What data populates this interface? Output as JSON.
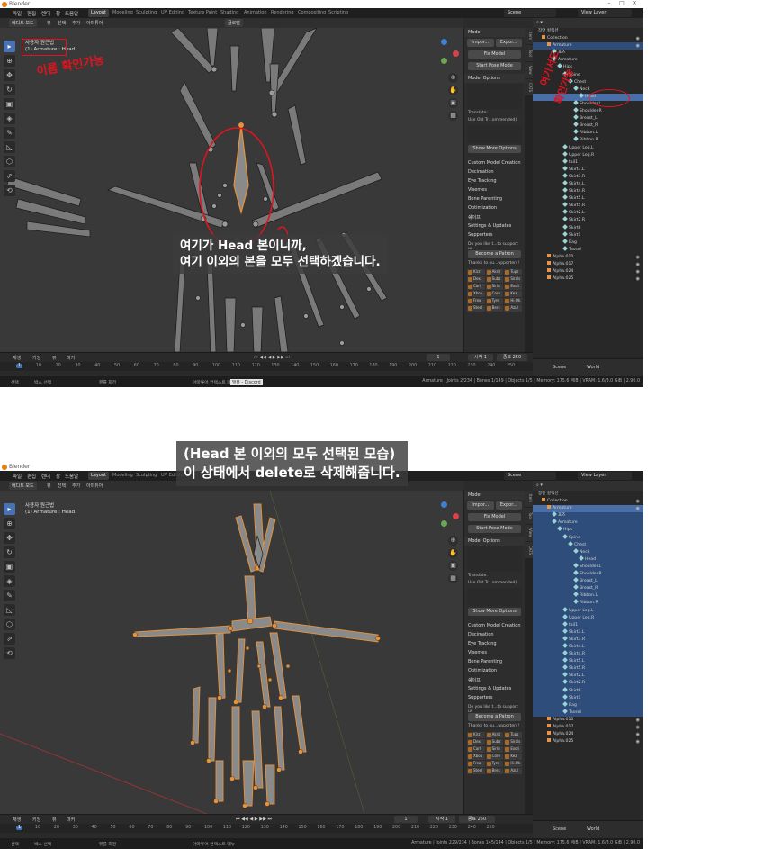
{
  "app": {
    "title": "Blender"
  },
  "menu": [
    "파일",
    "편집",
    "렌더",
    "창",
    "도움말"
  ],
  "workspaces": [
    "Layout",
    "Modeling",
    "Sculpting",
    "UV Editing",
    "Texture Paint",
    "Shading",
    "Animation",
    "Rendering",
    "Compositing",
    "Scripting"
  ],
  "scene": {
    "scene_label": "Scene",
    "view_layer_label": "View Layer"
  },
  "vp_header": {
    "mode": "에디트 모드",
    "view": "뷰",
    "select": "선택",
    "add": "추가",
    "armature": "아마튜어",
    "transform": "글로벌"
  },
  "viewport_info": {
    "line1": "사용자 원근법",
    "line2": "(1) Armature : Head"
  },
  "npanel": {
    "model": "Model",
    "import": "Impor...",
    "export": "Expor...",
    "fix_model": "Fix Model",
    "start_pose": "Start Pose Mode",
    "model_options": "Model Options",
    "translate": "Translate:",
    "use_old": "Use Old Tr...ommended)",
    "show_more": "Show More Options",
    "sections": [
      "Custom Model Creation",
      "Decimation",
      "Eye Tracking",
      "Visemes",
      "Bone Parenting",
      "Optimization",
      "쉐이프",
      "Settings & Updates",
      "Supporters"
    ],
    "support_text": "Do you like t...to support us",
    "patron": "Become a Patron",
    "thanks": "Thanks to ou...upporters!",
    "supporters": [
      "Kirz",
      "Akrit",
      "Tups",
      "Dex",
      "Subz",
      "Sirals",
      "Carl",
      "Sirlu",
      "Exoli",
      "Xbou",
      "Core",
      "Kez",
      "Frea",
      "Tyre",
      "Hi.Ok",
      "Steel",
      "Bers",
      "Azul"
    ],
    "tabs": [
      "Item",
      "Tool",
      "View",
      "CATS"
    ]
  },
  "outliner": {
    "header": "장면 컬렉션",
    "rows": [
      {
        "name": "Collection",
        "indent": 1,
        "kind": "col"
      },
      {
        "name": "Armature",
        "indent": 2,
        "kind": "obj"
      },
      {
        "name": "포즈",
        "indent": 3,
        "kind": "pose"
      },
      {
        "name": "Armature",
        "indent": 3,
        "kind": "arm"
      },
      {
        "name": "Hips",
        "indent": 4,
        "kind": "bone"
      },
      {
        "name": "Spine",
        "indent": 5,
        "kind": "bone"
      },
      {
        "name": "Chest",
        "indent": 6,
        "kind": "bone"
      },
      {
        "name": "Neck",
        "indent": 7,
        "kind": "bone"
      },
      {
        "name": "Head",
        "indent": 8,
        "kind": "bone"
      },
      {
        "name": "Shoulder.L",
        "indent": 7,
        "kind": "bone"
      },
      {
        "name": "Shoulder.R",
        "indent": 7,
        "kind": "bone"
      },
      {
        "name": "Breast_L",
        "indent": 7,
        "kind": "bone"
      },
      {
        "name": "Breast_R",
        "indent": 7,
        "kind": "bone"
      },
      {
        "name": "Ribbon.L",
        "indent": 7,
        "kind": "bone"
      },
      {
        "name": "Ribbon.R",
        "indent": 7,
        "kind": "bone"
      },
      {
        "name": "Upper Leg.L",
        "indent": 5,
        "kind": "bone"
      },
      {
        "name": "Upper Leg.R",
        "indent": 5,
        "kind": "bone"
      },
      {
        "name": "tail1",
        "indent": 5,
        "kind": "bone"
      },
      {
        "name": "Skirt3.L",
        "indent": 5,
        "kind": "bone"
      },
      {
        "name": "Skirt3.R",
        "indent": 5,
        "kind": "bone"
      },
      {
        "name": "Skirt4.L",
        "indent": 5,
        "kind": "bone"
      },
      {
        "name": "Skirt4.R",
        "indent": 5,
        "kind": "bone"
      },
      {
        "name": "Skirt5.L",
        "indent": 5,
        "kind": "bone"
      },
      {
        "name": "Skirt5.R",
        "indent": 5,
        "kind": "bone"
      },
      {
        "name": "Skirt2.L",
        "indent": 5,
        "kind": "bone"
      },
      {
        "name": "Skirt2.R",
        "indent": 5,
        "kind": "bone"
      },
      {
        "name": "Skirt6",
        "indent": 5,
        "kind": "bone"
      },
      {
        "name": "Skirt1",
        "indent": 5,
        "kind": "bone"
      },
      {
        "name": "Bag",
        "indent": 5,
        "kind": "bone"
      },
      {
        "name": "Tassel",
        "indent": 5,
        "kind": "bone"
      },
      {
        "name": "Alpha.010",
        "indent": 2,
        "kind": "obj"
      },
      {
        "name": "Alpha.017",
        "indent": 2,
        "kind": "obj"
      },
      {
        "name": "Alpha.024",
        "indent": 2,
        "kind": "obj"
      },
      {
        "name": "Alpha.025",
        "indent": 2,
        "kind": "obj"
      }
    ]
  },
  "props": {
    "scene": "Scene",
    "world": "World"
  },
  "timeline": {
    "playback": "재생",
    "keying": "키잉",
    "view": "뷰",
    "marker": "마커",
    "current_frame": "1",
    "start_label": "시작",
    "start": "1",
    "end_label": "종료",
    "end": "250",
    "ticks": [
      "1",
      "10",
      "20",
      "30",
      "40",
      "50",
      "60",
      "70",
      "80",
      "90",
      "100",
      "110",
      "120",
      "130",
      "140",
      "150",
      "160",
      "170",
      "180",
      "190",
      "200",
      "210",
      "220",
      "230",
      "240",
      "250"
    ]
  },
  "status": {
    "select": "선택",
    "box_select": "박스 선택",
    "rotate": "뷰를 회전",
    "context_menu": "아마튜어 컨텍스트 메뉴",
    "discord_tooltip": "말풍 - Discord",
    "stats1": "Armature | Joints 2/234 | Bones 1/149 | Objects 1/5 | Memory: 175.6 MiB | VRAM: 1.6/3.0 GiB | 2.90.0",
    "stats2": "Armature | Joints 229/234 | Bones 145/144 | Objects 1/5 | Memory: 175.6 MiB | VRAM: 1.6/3.0 GiB | 2.90.0"
  },
  "overlay1": {
    "line1": "여기가 Head 본이니까,",
    "line2": "여기 이외의 본을 모두 선택하겠습니다."
  },
  "overlay2": {
    "line1": "(Head 본 이외의 모두 선택된 모습)",
    "line2": "이 상태에서 delete로 삭제해줍니다."
  },
  "annotations": {
    "name_check": "이름 확인가능",
    "here_check_1": "여기서도",
    "here_check_2": "확인가능"
  },
  "colors": {
    "selected_bone": "#e8923a",
    "accent": "#4772b3",
    "annotation": "#e0141e"
  }
}
